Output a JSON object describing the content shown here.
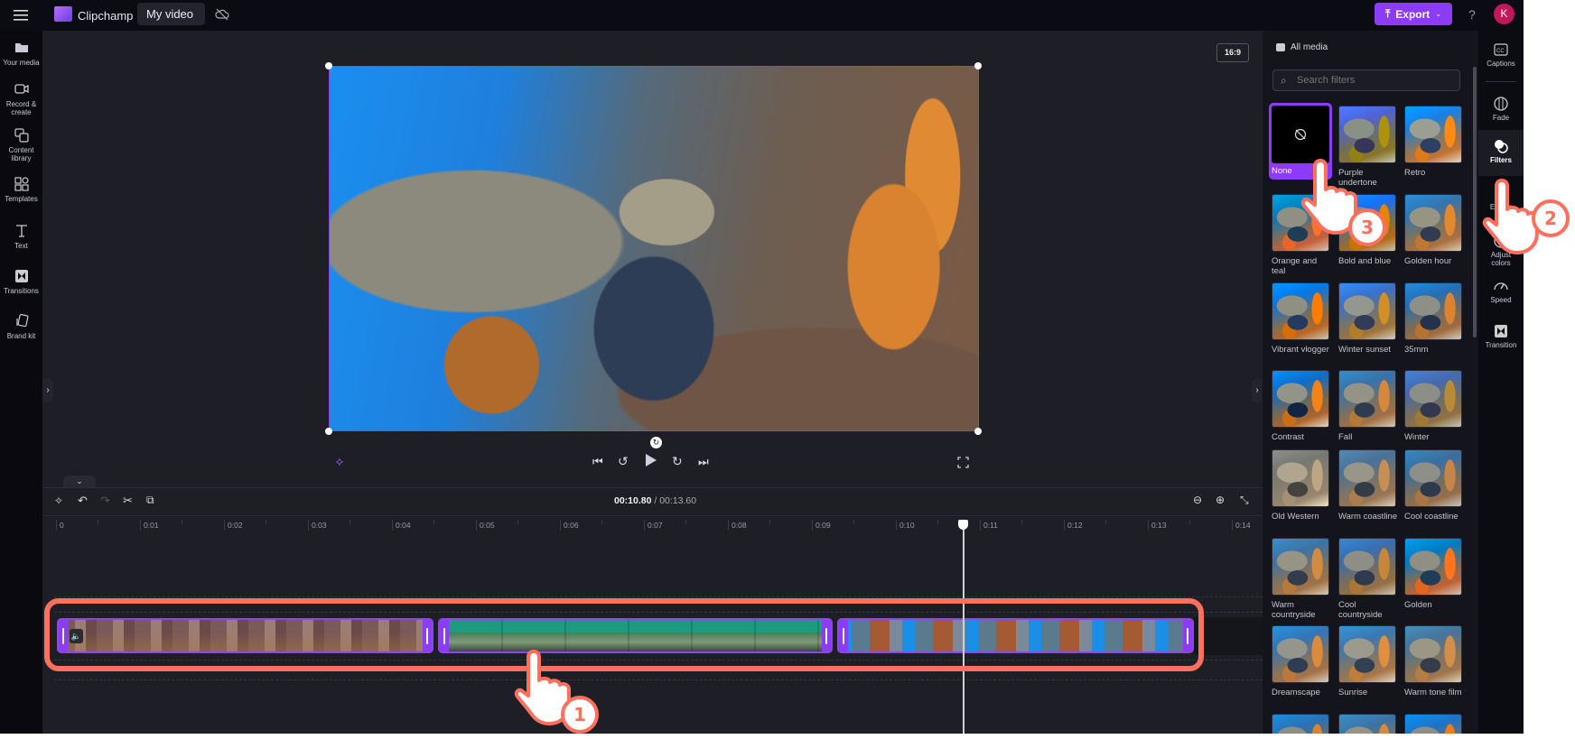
{
  "topbar": {
    "app_name": "Clipchamp",
    "project_name": "My video",
    "export_label": "Export",
    "help_label": "?",
    "avatar_initial": "K"
  },
  "sidebar": {
    "items": [
      {
        "label": "Your media",
        "icon": "folder-icon"
      },
      {
        "label": "Record &\ncreate",
        "icon": "camera-icon"
      },
      {
        "label": "Content\nlibrary",
        "icon": "library-icon"
      },
      {
        "label": "Templates",
        "icon": "templates-icon"
      },
      {
        "label": "Text",
        "icon": "text-icon"
      },
      {
        "label": "Transitions",
        "icon": "transitions-icon"
      },
      {
        "label": "Brand kit",
        "icon": "brand-kit-icon"
      }
    ]
  },
  "preview": {
    "aspect_ratio": "16:9"
  },
  "timeline": {
    "current_time": "00:10.80",
    "total_time": "/ 00:13.60",
    "current_seconds": 10.8,
    "ruler": [
      "0",
      "0:01",
      "0:02",
      "0:03",
      "0:04",
      "0:05",
      "0:06",
      "0:07",
      "0:08",
      "0:09",
      "0:10",
      "0:11",
      "0:12",
      "0:13",
      "0:14"
    ]
  },
  "panel": {
    "section_label": "All media",
    "search_placeholder": "Search filters",
    "selected": "None",
    "filters": [
      "None",
      "Purple undertone",
      "Retro",
      "Orange and teal",
      "Bold and blue",
      "Golden hour",
      "Vibrant vlogger",
      "Winter sunset",
      "35mm",
      "Contrast",
      "Fall",
      "Winter",
      "Old Western",
      "Warm coastline",
      "Cool coastline",
      "Warm countryside",
      "Cool countryside",
      "Golden",
      "Dreamscape",
      "Sunrise",
      "Warm tone film",
      "",
      "",
      ""
    ]
  },
  "rail": {
    "items": [
      {
        "label": "Captions",
        "icon": "captions-icon"
      },
      {
        "label": "Fade",
        "icon": "fade-icon"
      },
      {
        "label": "Filters",
        "icon": "filters-icon",
        "active": true
      },
      {
        "label": "Effects",
        "icon": "effects-icon"
      },
      {
        "label": "Adjust\ncolors",
        "icon": "adjust-colors-icon"
      },
      {
        "label": "Speed",
        "icon": "speed-icon"
      },
      {
        "label": "Transition",
        "icon": "transition-icon"
      }
    ]
  },
  "annotations": {
    "step1": "1",
    "step2": "2",
    "step3": "3"
  },
  "colors": {
    "accent": "#8c3cf6",
    "annotation": "#ff6f5e",
    "avatar": "#c2185b"
  }
}
